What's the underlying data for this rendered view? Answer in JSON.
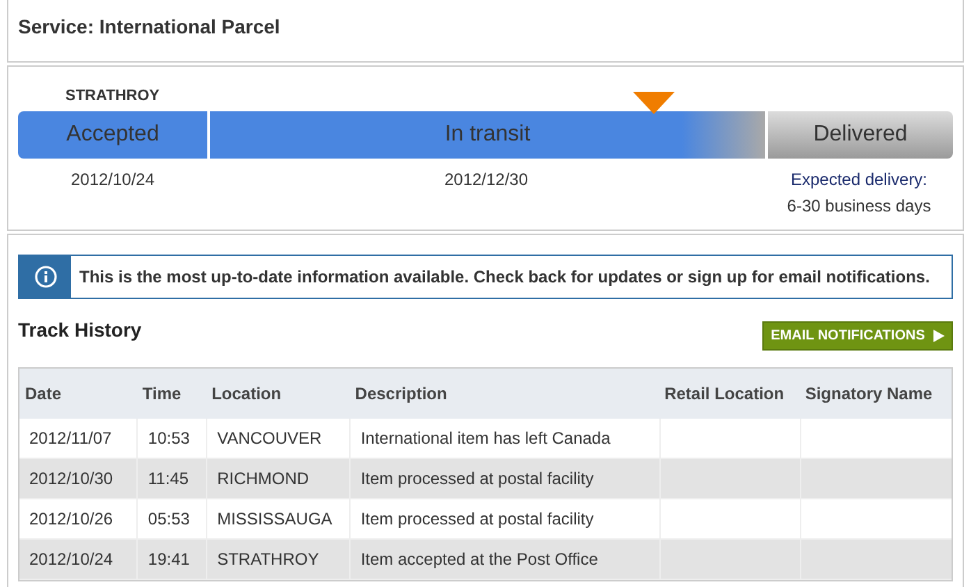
{
  "service_title": "Service: International Parcel",
  "progress": {
    "origin": "STRATHROY",
    "stages": [
      {
        "label": "Accepted",
        "reached": true,
        "date": "2012/10/24"
      },
      {
        "label": "In transit",
        "reached": true,
        "date": "2012/12/30"
      },
      {
        "label": "Delivered",
        "reached": false,
        "note": [
          "Expected delivery:",
          "6-30 business days"
        ]
      }
    ]
  },
  "info_message": "This is the most up-to-date information available. Check back for updates or sign up for email notifications.",
  "track_history": {
    "title": "Track History",
    "button": "EMAIL NOTIFICATIONS",
    "columns": [
      "Date",
      "Time",
      "Location",
      "Description",
      "Retail Location",
      "Signatory Name"
    ],
    "rows": [
      [
        "2012/11/07",
        "10:53",
        "VANCOUVER",
        "International item has left Canada",
        "",
        ""
      ],
      [
        "2012/10/30",
        "11:45",
        "RICHMOND",
        "Item processed at postal facility",
        "",
        ""
      ],
      [
        "2012/10/26",
        "05:53",
        "MISSISSAUGA",
        "Item processed at postal facility",
        "",
        ""
      ],
      [
        "2012/10/24",
        "19:41",
        "STRATHROY",
        "Item accepted at the Post Office",
        "",
        ""
      ]
    ]
  }
}
